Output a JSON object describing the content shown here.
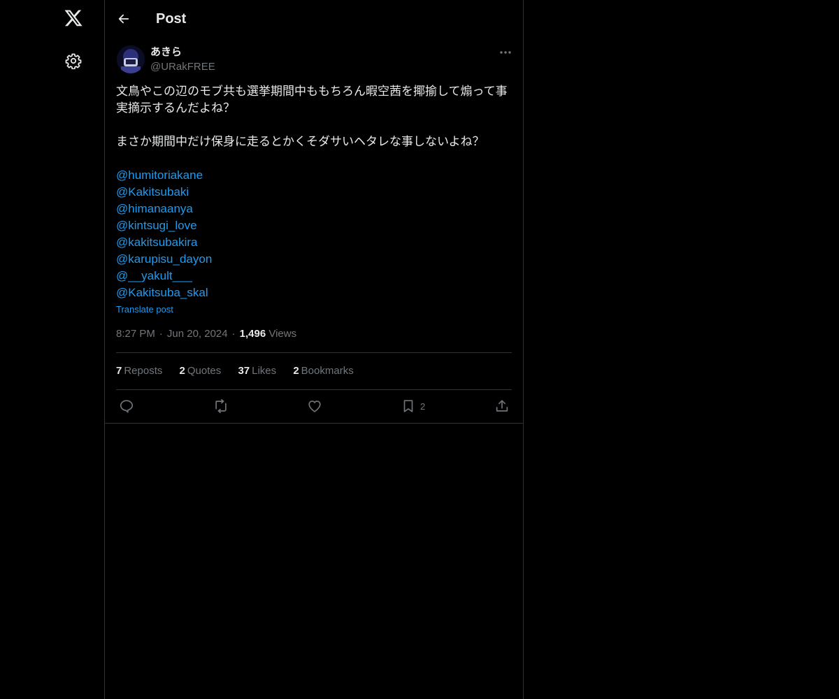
{
  "header": {
    "title": "Post"
  },
  "tweet": {
    "display_name": "あきら",
    "handle": "@URakFREE",
    "text_lines": [
      "文鳥やこの辺のモブ共も選挙期間中ももちろん暇空茜を揶揄して煽って事",
      "実摘示するんだよね？",
      "",
      "まさか期間中だけ保身に走るとかくそダサいヘタレな事しないよね？",
      ""
    ],
    "mentions": [
      "@humitoriakane",
      "@Kakitsubaki",
      "@himanaanya",
      "@kintsugi_love",
      "@kakitsubakira",
      "@karupisu_dayon",
      "@__yakult___",
      "@Kakitsuba_skal"
    ],
    "translate_label": "Translate post",
    "time": "8:27 PM",
    "date": "Jun 20, 2024",
    "separator": "·",
    "views_count": "1,496",
    "views_label": "Views"
  },
  "stats": {
    "reposts_count": "7",
    "reposts_label": "Reposts",
    "quotes_count": "2",
    "quotes_label": "Quotes",
    "likes_count": "37",
    "likes_label": "Likes",
    "bookmarks_count": "2",
    "bookmarks_label": "Bookmarks"
  },
  "actions": {
    "reply_icon": "reply-icon",
    "repost_icon": "repost-icon",
    "like_icon": "heart-icon",
    "bookmark_icon": "bookmark-icon",
    "bookmark_count": "2",
    "share_icon": "share-icon"
  },
  "nav": {
    "logo_icon": "x-logo-icon",
    "settings_icon": "gear-icon"
  },
  "colors": {
    "background": "#000000",
    "text_primary": "#e7e9ea",
    "text_secondary": "#71767b",
    "link": "#1d9bf0",
    "border": "#2f3336"
  }
}
